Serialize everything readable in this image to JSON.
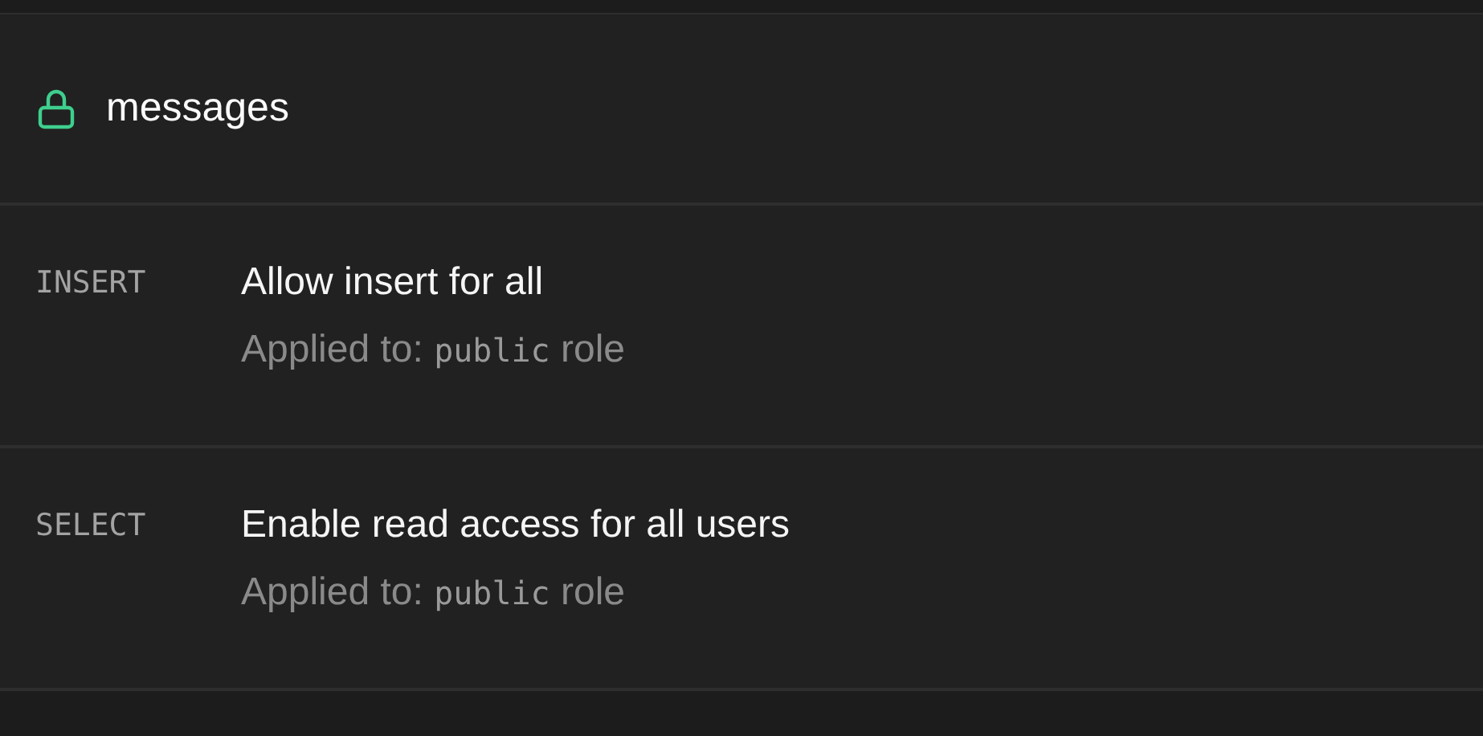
{
  "table": {
    "name": "messages",
    "locked": true
  },
  "policies": [
    {
      "command": "INSERT",
      "name": "Allow insert for all",
      "applied_to": {
        "prefix": "Applied to:",
        "role": "public",
        "suffix": "role"
      }
    },
    {
      "command": "SELECT",
      "name": "Enable read access for all users",
      "applied_to": {
        "prefix": "Applied to:",
        "role": "public",
        "suffix": "role"
      }
    }
  ]
}
